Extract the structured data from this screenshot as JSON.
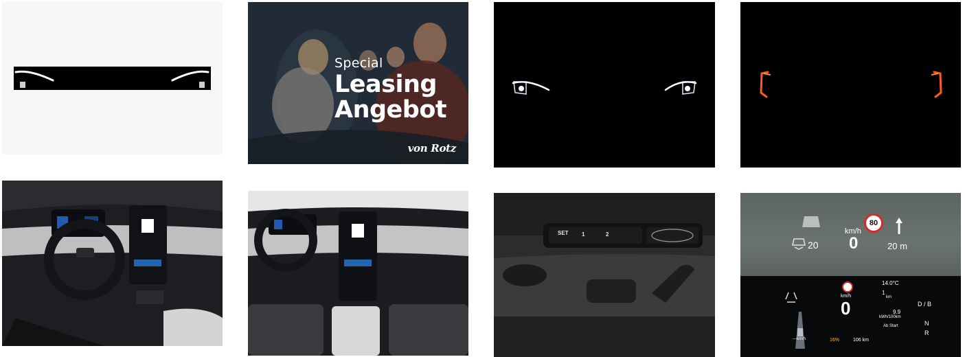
{
  "gallery": {
    "promo": {
      "line1": "Special",
      "line2": "Leasing",
      "line3": "Angebot",
      "brand": "von Rotz"
    },
    "seat": {
      "set": "SET",
      "m1": "1",
      "m2": "2"
    },
    "hud": {
      "distance_gap": "20",
      "unit": "km/h",
      "speed": "0",
      "speed_limit": "80",
      "nav_distance": "20 m"
    },
    "cluster": {
      "unit": "km/h",
      "speed": "0",
      "temperature": "14.0°C",
      "trip_distance": "1",
      "trip_unit": "km",
      "consumption": "9.9",
      "consumption_unit": "kWh/100km",
      "consumption_label": "Ab Start",
      "acc_speed": "---km/h",
      "battery_percent": "16%",
      "range": "106 km",
      "gear_d": "D / B",
      "gear_n": "N",
      "gear_r": "R"
    },
    "colors": {
      "promo_text": "#ffffff",
      "tail_light": "#ff5a1a",
      "speed_limit_ring": "#d42a2a",
      "battery_yellow": "#f2c21b"
    }
  }
}
